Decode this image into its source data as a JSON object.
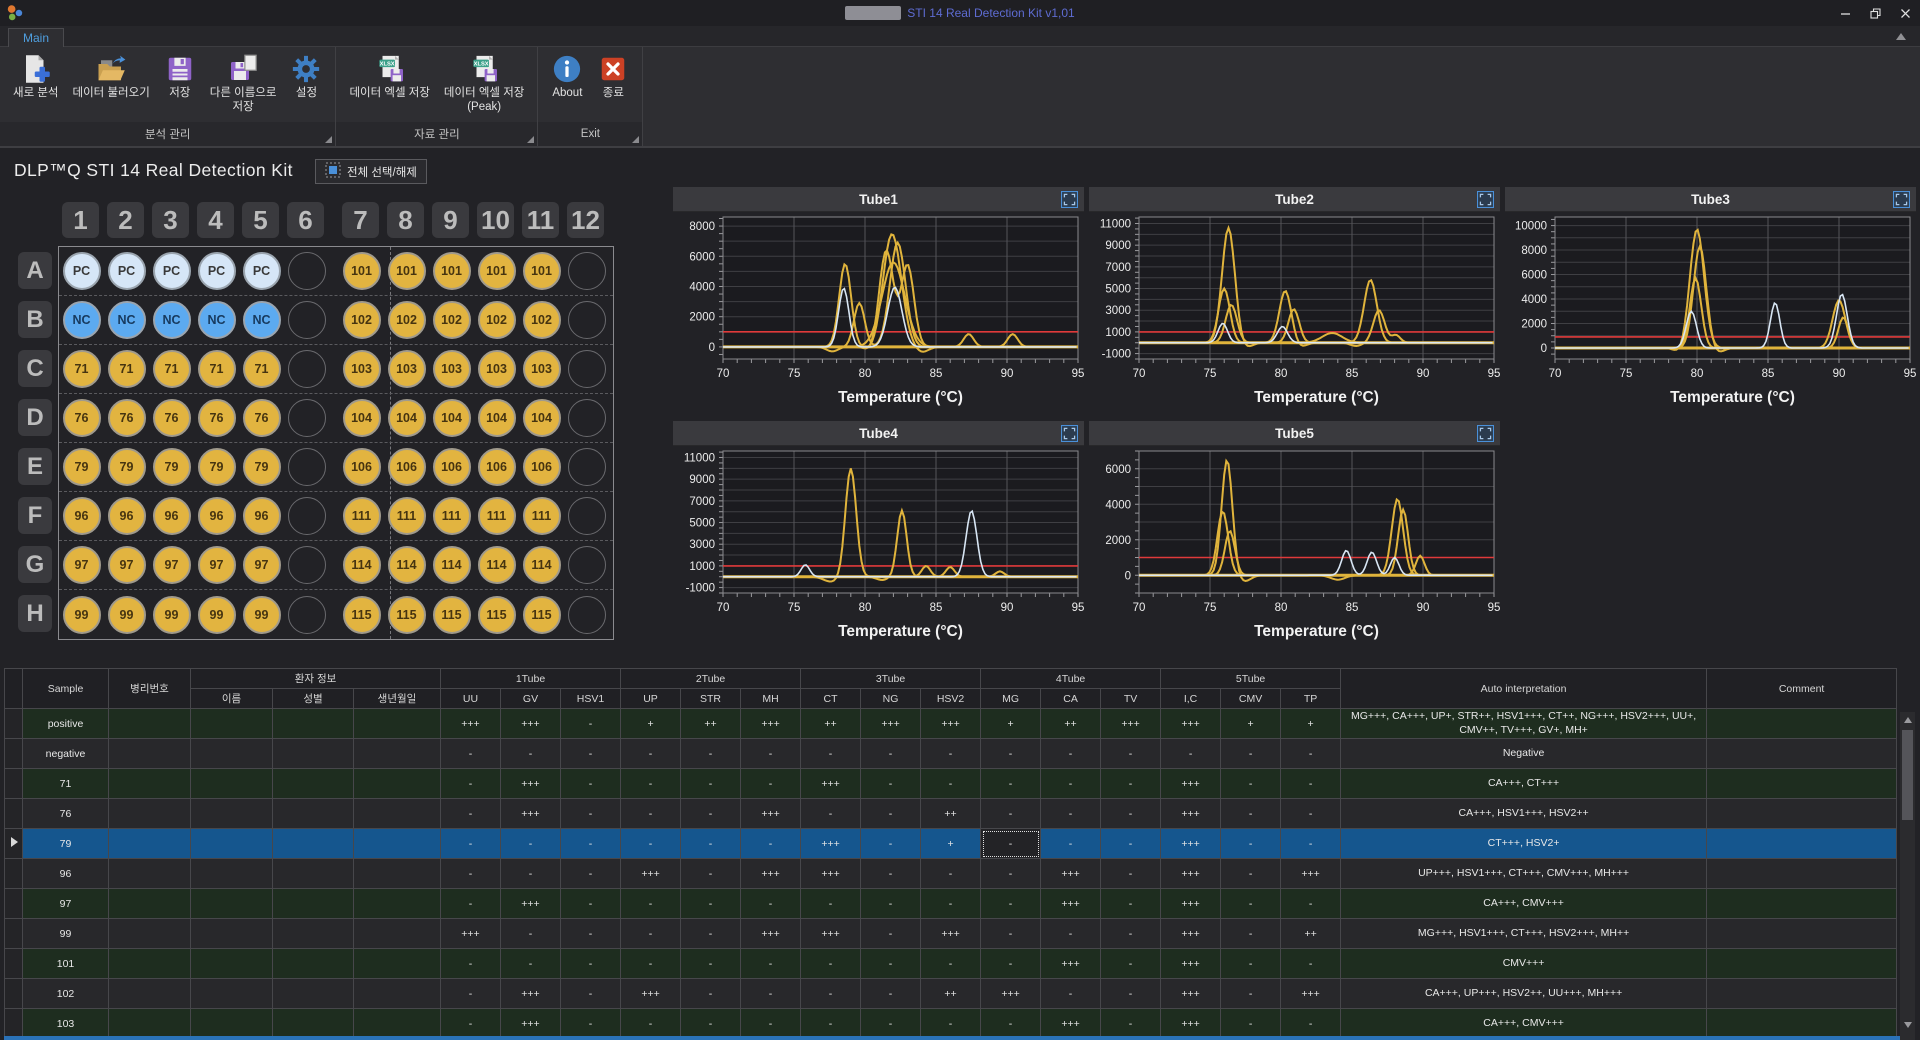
{
  "window": {
    "title": "STI 14 Real Detection Kit v1,01",
    "tab": "Main",
    "controls": [
      "minimize",
      "maximize",
      "close"
    ]
  },
  "ribbon": {
    "groups": [
      {
        "label": "분석 관리",
        "buttons": [
          {
            "id": "new-analysis",
            "icon": "new-analysis-icon",
            "lines": [
              "새로 분석"
            ]
          },
          {
            "id": "load-data",
            "icon": "load-data-icon",
            "lines": [
              "데이터 불러오기"
            ]
          },
          {
            "id": "save",
            "icon": "save-icon",
            "lines": [
              "저장"
            ]
          },
          {
            "id": "save-as",
            "icon": "save-as-icon",
            "lines": [
              "다른 이름으로",
              "저장"
            ]
          },
          {
            "id": "settings",
            "icon": "settings-icon",
            "lines": [
              "설정"
            ]
          }
        ]
      },
      {
        "label": "자료 관리",
        "buttons": [
          {
            "id": "excel-save",
            "icon": "excel-save-icon",
            "lines": [
              "데이터 엑셀 저장"
            ]
          },
          {
            "id": "excel-peak-save",
            "icon": "excel-save-icon",
            "lines": [
              "데이터 엑셀 저장",
              "(Peak)"
            ]
          }
        ]
      },
      {
        "label": "Exit",
        "buttons": [
          {
            "id": "about",
            "icon": "about-icon",
            "lines": [
              "About"
            ]
          },
          {
            "id": "exit",
            "icon": "exit-icon",
            "lines": [
              "종료"
            ]
          }
        ]
      }
    ]
  },
  "main": {
    "title": "DLP™Q STI 14 Real Detection Kit",
    "select_all_label": "전체 선택/해제"
  },
  "plate": {
    "column_headers": [
      "1",
      "2",
      "3",
      "4",
      "5",
      "6",
      "7",
      "8",
      "9",
      "10",
      "11",
      "12"
    ],
    "rows": [
      {
        "label": "A",
        "left": "PC",
        "left_type": "pc",
        "right": "101",
        "right_type": "sample"
      },
      {
        "label": "B",
        "left": "NC",
        "left_type": "nc",
        "right": "102",
        "right_type": "sample"
      },
      {
        "label": "C",
        "left": "71",
        "left_type": "sample",
        "right": "103",
        "right_type": "sample"
      },
      {
        "label": "D",
        "left": "76",
        "left_type": "sample",
        "right": "104",
        "right_type": "sample"
      },
      {
        "label": "E",
        "left": "79",
        "left_type": "sample",
        "right": "106",
        "right_type": "sample"
      },
      {
        "label": "F",
        "left": "96",
        "left_type": "sample",
        "right": "111",
        "right_type": "sample"
      },
      {
        "label": "G",
        "left": "97",
        "left_type": "sample",
        "right": "114",
        "right_type": "sample"
      },
      {
        "label": "H",
        "left": "99",
        "left_type": "sample",
        "right": "115",
        "right_type": "sample"
      }
    ]
  },
  "chart_data": {
    "type": "line",
    "xlabel": "Temperature (°C)",
    "x_ticks": [
      70,
      75,
      80,
      85,
      90,
      95
    ],
    "xlim": [
      70,
      95
    ],
    "colors": {
      "curve": "#e0b43c",
      "alt_curve": "#d8e6f4",
      "threshold": "#e03a3a"
    },
    "tubes": [
      {
        "title": "Tube1",
        "ylim": [
          -800,
          8600
        ],
        "y_ticks": [
          0,
          2000,
          4000,
          6000,
          8000
        ],
        "threshold": 1000,
        "series": [
          {
            "color": "yellow",
            "peaks": [
              [
                78.6,
                5500,
                0.42
              ],
              [
                81.9,
                7500,
                0.65
              ],
              [
                90.4,
                850,
                0.35
              ],
              [
                80.7,
                -400,
                0.5
              ],
              [
                84.0,
                -350,
                0.45
              ]
            ]
          },
          {
            "color": "yellow",
            "peaks": [
              [
                79.6,
                2900,
                0.38
              ],
              [
                82.3,
                6900,
                0.55
              ],
              [
                87.3,
                850,
                0.35
              ],
              [
                77.7,
                -300,
                0.4
              ]
            ]
          },
          {
            "color": "yellow",
            "peaks": [
              [
                81.5,
                6400,
                0.5
              ],
              [
                83.0,
                5400,
                0.45
              ],
              [
                80.5,
                -350,
                0.4
              ]
            ]
          },
          {
            "color": "yellow",
            "peaks": [
              [
                82.0,
                5600,
                0.8
              ]
            ]
          },
          {
            "color": "white",
            "peaks": [
              [
                78.5,
                3900,
                0.36
              ],
              [
                82.1,
                3950,
                0.5
              ]
            ]
          }
        ]
      },
      {
        "title": "Tube2",
        "ylim": [
          -1500,
          11600
        ],
        "y_ticks": [
          -1000,
          1000,
          3000,
          5000,
          7000,
          9000,
          11000
        ],
        "threshold": 1000,
        "series": [
          {
            "color": "yellow",
            "peaks": [
              [
                76.3,
                10600,
                0.45
              ],
              [
                83.6,
                900,
                0.7
              ],
              [
                77.6,
                -400,
                0.4
              ]
            ]
          },
          {
            "color": "yellow",
            "peaks": [
              [
                76.0,
                5000,
                0.4
              ],
              [
                80.3,
                4800,
                0.42
              ],
              [
                86.3,
                5800,
                0.45
              ],
              [
                81.4,
                -350,
                0.4
              ]
            ]
          },
          {
            "color": "yellow",
            "peaks": [
              [
                76.5,
                3500,
                0.4
              ],
              [
                80.9,
                3100,
                0.38
              ],
              [
                86.9,
                3000,
                0.4
              ],
              [
                88.1,
                700,
                0.3
              ],
              [
                85.3,
                -300,
                0.4
              ]
            ]
          },
          {
            "color": "white",
            "peaks": [
              [
                75.9,
                1800,
                0.33
              ],
              [
                80.1,
                1500,
                0.36
              ]
            ]
          }
        ]
      },
      {
        "title": "Tube3",
        "ylim": [
          -900,
          10700
        ],
        "y_ticks": [
          0,
          2000,
          4000,
          6000,
          8000,
          10000
        ],
        "threshold": 900,
        "series": [
          {
            "color": "yellow",
            "peaks": [
              [
                80.0,
                9700,
                0.5
              ],
              [
                78.8,
                -350,
                0.4
              ]
            ]
          },
          {
            "color": "yellow",
            "peaks": [
              [
                80.2,
                8300,
                0.45
              ],
              [
                90.0,
                3900,
                0.45
              ],
              [
                81.5,
                -350,
                0.4
              ]
            ]
          },
          {
            "color": "yellow",
            "peaks": [
              [
                79.9,
                5700,
                0.4
              ],
              [
                90.3,
                2500,
                0.35
              ]
            ]
          },
          {
            "color": "white",
            "peaks": [
              [
                79.6,
                3000,
                0.36
              ],
              [
                85.5,
                3700,
                0.33
              ],
              [
                90.2,
                4400,
                0.38
              ]
            ]
          }
        ]
      },
      {
        "title": "Tube4",
        "ylim": [
          -1500,
          11600
        ],
        "y_ticks": [
          -1000,
          1000,
          3000,
          5000,
          7000,
          9000,
          11000
        ],
        "threshold": 1000,
        "series": [
          {
            "color": "yellow",
            "peaks": [
              [
                79.0,
                10000,
                0.38
              ],
              [
                84.3,
                1000,
                0.3
              ],
              [
                77.6,
                -450,
                0.5
              ]
            ]
          },
          {
            "color": "yellow",
            "peaks": [
              [
                82.6,
                6100,
                0.33
              ],
              [
                86.0,
                900,
                0.3
              ],
              [
                89.5,
                500,
                0.3
              ],
              [
                81.2,
                -300,
                0.4
              ]
            ]
          },
          {
            "color": "white",
            "peaks": [
              [
                75.8,
                1100,
                0.3
              ],
              [
                87.5,
                6100,
                0.38
              ]
            ]
          }
        ]
      },
      {
        "title": "Tube5",
        "ylim": [
          -1000,
          7000
        ],
        "y_ticks": [
          0,
          2000,
          4000,
          6000
        ],
        "threshold": 1000,
        "series": [
          {
            "color": "yellow",
            "peaks": [
              [
                76.2,
                6500,
                0.38
              ],
              [
                89.8,
                1100,
                0.3
              ],
              [
                77.4,
                -350,
                0.45
              ]
            ]
          },
          {
            "color": "yellow",
            "peaks": [
              [
                75.9,
                3600,
                0.38
              ],
              [
                88.2,
                4300,
                0.4
              ],
              [
                84.0,
                -250,
                0.5
              ]
            ]
          },
          {
            "color": "yellow",
            "peaks": [
              [
                76.4,
                2500,
                0.35
              ],
              [
                88.6,
                3700,
                0.35
              ]
            ]
          },
          {
            "color": "white",
            "peaks": [
              [
                84.6,
                1400,
                0.33
              ],
              [
                86.4,
                1300,
                0.33
              ],
              [
                88.0,
                1000,
                0.3
              ]
            ]
          }
        ]
      }
    ]
  },
  "table": {
    "columns": {
      "sample": "Sample",
      "pathology_no": "병리번호",
      "patient_group": "환자 정보",
      "patient_cols": [
        "이름",
        "성별",
        "생년월일"
      ],
      "tube_groups": [
        {
          "label": "1Tube",
          "cols": [
            "UU",
            "GV",
            "HSV1"
          ]
        },
        {
          "label": "2Tube",
          "cols": [
            "UP",
            "STR",
            "MH"
          ]
        },
        {
          "label": "3Tube",
          "cols": [
            "CT",
            "NG",
            "HSV2"
          ]
        },
        {
          "label": "4Tube",
          "cols": [
            "MG",
            "CA",
            "TV"
          ]
        },
        {
          "label": "5Tube",
          "cols": [
            "I,C",
            "CMV",
            "TP"
          ]
        }
      ],
      "auto": "Auto interpretation",
      "comment": "Comment"
    },
    "rows": [
      {
        "sample": "positive",
        "pathology_no": "",
        "patient": [
          "",
          "",
          ""
        ],
        "tone": "green",
        "selected": false,
        "values": [
          "+++",
          "+++",
          "-",
          "+",
          "++",
          "+++",
          "++",
          "+++",
          "+++",
          "+",
          "++",
          "+++",
          "+++",
          "+",
          "+"
        ],
        "interpretation": "MG+++, CA+++, UP+, STR++, HSV1+++, CT++, NG+++, HSV2+++, UU+, CMV++, TV+++, GV+, MH+",
        "comment": ""
      },
      {
        "sample": "negative",
        "pathology_no": "",
        "patient": [
          "",
          "",
          ""
        ],
        "tone": "dark",
        "selected": false,
        "values": [
          "-",
          "-",
          "-",
          "-",
          "-",
          "-",
          "-",
          "-",
          "-",
          "-",
          "-",
          "-",
          "-",
          "-",
          "-"
        ],
        "interpretation": "Negative",
        "comment": ""
      },
      {
        "sample": "71",
        "pathology_no": "",
        "patient": [
          "",
          "",
          ""
        ],
        "tone": "green",
        "selected": false,
        "values": [
          "-",
          "+++",
          "-",
          "-",
          "-",
          "-",
          "+++",
          "-",
          "-",
          "-",
          "-",
          "-",
          "+++",
          "-",
          "-"
        ],
        "interpretation": "CA+++, CT+++",
        "comment": ""
      },
      {
        "sample": "76",
        "pathology_no": "",
        "patient": [
          "",
          "",
          ""
        ],
        "tone": "dark",
        "selected": false,
        "values": [
          "-",
          "+++",
          "-",
          "-",
          "-",
          "+++",
          "-",
          "-",
          "++",
          "-",
          "-",
          "-",
          "+++",
          "-",
          "-"
        ],
        "interpretation": "CA+++, HSV1+++, HSV2++",
        "comment": ""
      },
      {
        "sample": "79",
        "pathology_no": "",
        "patient": [
          "",
          "",
          ""
        ],
        "tone": "green",
        "selected": true,
        "focused_col": 9,
        "values": [
          "-",
          "-",
          "-",
          "-",
          "-",
          "-",
          "+++",
          "-",
          "+",
          "-",
          "-",
          "-",
          "+++",
          "-",
          "-"
        ],
        "interpretation": "CT+++, HSV2+",
        "comment": ""
      },
      {
        "sample": "96",
        "pathology_no": "",
        "patient": [
          "",
          "",
          ""
        ],
        "tone": "dark",
        "selected": false,
        "values": [
          "-",
          "-",
          "-",
          "+++",
          "-",
          "+++",
          "+++",
          "-",
          "-",
          "-",
          "+++",
          "-",
          "+++",
          "-",
          "+++"
        ],
        "interpretation": "UP+++, HSV1+++, CT+++, CMV+++, MH+++",
        "comment": ""
      },
      {
        "sample": "97",
        "pathology_no": "",
        "patient": [
          "",
          "",
          ""
        ],
        "tone": "green",
        "selected": false,
        "values": [
          "-",
          "+++",
          "-",
          "-",
          "-",
          "-",
          "-",
          "-",
          "-",
          "-",
          "+++",
          "-",
          "+++",
          "-",
          "-"
        ],
        "interpretation": "CA+++, CMV+++",
        "comment": ""
      },
      {
        "sample": "99",
        "pathology_no": "",
        "patient": [
          "",
          "",
          ""
        ],
        "tone": "dark",
        "selected": false,
        "values": [
          "+++",
          "-",
          "-",
          "-",
          "-",
          "+++",
          "+++",
          "-",
          "+++",
          "-",
          "-",
          "-",
          "+++",
          "-",
          "++"
        ],
        "interpretation": "MG+++, HSV1+++, CT+++, HSV2+++, MH++",
        "comment": ""
      },
      {
        "sample": "101",
        "pathology_no": "",
        "patient": [
          "",
          "",
          ""
        ],
        "tone": "green",
        "selected": false,
        "values": [
          "-",
          "-",
          "-",
          "-",
          "-",
          "-",
          "-",
          "-",
          "-",
          "-",
          "+++",
          "-",
          "+++",
          "-",
          "-"
        ],
        "interpretation": "CMV+++",
        "comment": ""
      },
      {
        "sample": "102",
        "pathology_no": "",
        "patient": [
          "",
          "",
          ""
        ],
        "tone": "dark",
        "selected": false,
        "values": [
          "-",
          "+++",
          "-",
          "+++",
          "-",
          "-",
          "-",
          "-",
          "++",
          "+++",
          "-",
          "-",
          "+++",
          "-",
          "+++"
        ],
        "interpretation": "CA+++, UP+++, HSV2++, UU+++, MH+++",
        "comment": ""
      },
      {
        "sample": "103",
        "pathology_no": "",
        "patient": [
          "",
          "",
          ""
        ],
        "tone": "green",
        "selected": false,
        "values": [
          "-",
          "+++",
          "-",
          "-",
          "-",
          "-",
          "-",
          "-",
          "-",
          "-",
          "+++",
          "-",
          "+++",
          "-",
          "-"
        ],
        "interpretation": "CA+++, CMV+++",
        "comment": ""
      }
    ]
  }
}
